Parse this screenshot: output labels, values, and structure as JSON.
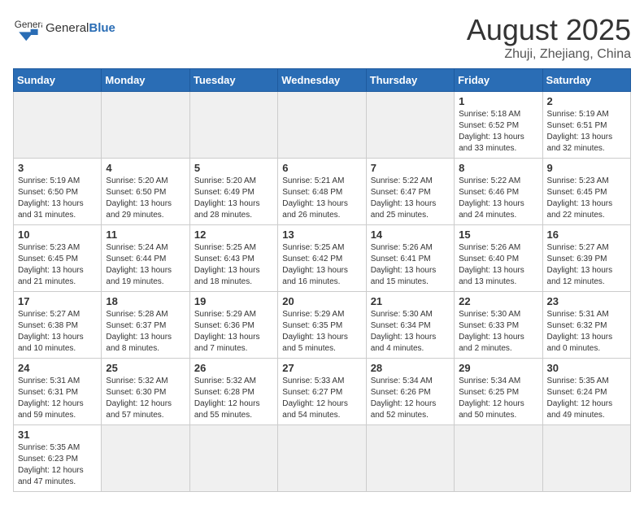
{
  "header": {
    "logo_general": "General",
    "logo_blue": "Blue",
    "title": "August 2025",
    "subtitle": "Zhuji, Zhejiang, China"
  },
  "weekdays": [
    "Sunday",
    "Monday",
    "Tuesday",
    "Wednesday",
    "Thursday",
    "Friday",
    "Saturday"
  ],
  "weeks": [
    [
      {
        "day": "",
        "info": ""
      },
      {
        "day": "",
        "info": ""
      },
      {
        "day": "",
        "info": ""
      },
      {
        "day": "",
        "info": ""
      },
      {
        "day": "",
        "info": ""
      },
      {
        "day": "1",
        "info": "Sunrise: 5:18 AM\nSunset: 6:52 PM\nDaylight: 13 hours\nand 33 minutes."
      },
      {
        "day": "2",
        "info": "Sunrise: 5:19 AM\nSunset: 6:51 PM\nDaylight: 13 hours\nand 32 minutes."
      }
    ],
    [
      {
        "day": "3",
        "info": "Sunrise: 5:19 AM\nSunset: 6:50 PM\nDaylight: 13 hours\nand 31 minutes."
      },
      {
        "day": "4",
        "info": "Sunrise: 5:20 AM\nSunset: 6:50 PM\nDaylight: 13 hours\nand 29 minutes."
      },
      {
        "day": "5",
        "info": "Sunrise: 5:20 AM\nSunset: 6:49 PM\nDaylight: 13 hours\nand 28 minutes."
      },
      {
        "day": "6",
        "info": "Sunrise: 5:21 AM\nSunset: 6:48 PM\nDaylight: 13 hours\nand 26 minutes."
      },
      {
        "day": "7",
        "info": "Sunrise: 5:22 AM\nSunset: 6:47 PM\nDaylight: 13 hours\nand 25 minutes."
      },
      {
        "day": "8",
        "info": "Sunrise: 5:22 AM\nSunset: 6:46 PM\nDaylight: 13 hours\nand 24 minutes."
      },
      {
        "day": "9",
        "info": "Sunrise: 5:23 AM\nSunset: 6:45 PM\nDaylight: 13 hours\nand 22 minutes."
      }
    ],
    [
      {
        "day": "10",
        "info": "Sunrise: 5:23 AM\nSunset: 6:45 PM\nDaylight: 13 hours\nand 21 minutes."
      },
      {
        "day": "11",
        "info": "Sunrise: 5:24 AM\nSunset: 6:44 PM\nDaylight: 13 hours\nand 19 minutes."
      },
      {
        "day": "12",
        "info": "Sunrise: 5:25 AM\nSunset: 6:43 PM\nDaylight: 13 hours\nand 18 minutes."
      },
      {
        "day": "13",
        "info": "Sunrise: 5:25 AM\nSunset: 6:42 PM\nDaylight: 13 hours\nand 16 minutes."
      },
      {
        "day": "14",
        "info": "Sunrise: 5:26 AM\nSunset: 6:41 PM\nDaylight: 13 hours\nand 15 minutes."
      },
      {
        "day": "15",
        "info": "Sunrise: 5:26 AM\nSunset: 6:40 PM\nDaylight: 13 hours\nand 13 minutes."
      },
      {
        "day": "16",
        "info": "Sunrise: 5:27 AM\nSunset: 6:39 PM\nDaylight: 13 hours\nand 12 minutes."
      }
    ],
    [
      {
        "day": "17",
        "info": "Sunrise: 5:27 AM\nSunset: 6:38 PM\nDaylight: 13 hours\nand 10 minutes."
      },
      {
        "day": "18",
        "info": "Sunrise: 5:28 AM\nSunset: 6:37 PM\nDaylight: 13 hours\nand 8 minutes."
      },
      {
        "day": "19",
        "info": "Sunrise: 5:29 AM\nSunset: 6:36 PM\nDaylight: 13 hours\nand 7 minutes."
      },
      {
        "day": "20",
        "info": "Sunrise: 5:29 AM\nSunset: 6:35 PM\nDaylight: 13 hours\nand 5 minutes."
      },
      {
        "day": "21",
        "info": "Sunrise: 5:30 AM\nSunset: 6:34 PM\nDaylight: 13 hours\nand 4 minutes."
      },
      {
        "day": "22",
        "info": "Sunrise: 5:30 AM\nSunset: 6:33 PM\nDaylight: 13 hours\nand 2 minutes."
      },
      {
        "day": "23",
        "info": "Sunrise: 5:31 AM\nSunset: 6:32 PM\nDaylight: 13 hours\nand 0 minutes."
      }
    ],
    [
      {
        "day": "24",
        "info": "Sunrise: 5:31 AM\nSunset: 6:31 PM\nDaylight: 12 hours\nand 59 minutes."
      },
      {
        "day": "25",
        "info": "Sunrise: 5:32 AM\nSunset: 6:30 PM\nDaylight: 12 hours\nand 57 minutes."
      },
      {
        "day": "26",
        "info": "Sunrise: 5:32 AM\nSunset: 6:28 PM\nDaylight: 12 hours\nand 55 minutes."
      },
      {
        "day": "27",
        "info": "Sunrise: 5:33 AM\nSunset: 6:27 PM\nDaylight: 12 hours\nand 54 minutes."
      },
      {
        "day": "28",
        "info": "Sunrise: 5:34 AM\nSunset: 6:26 PM\nDaylight: 12 hours\nand 52 minutes."
      },
      {
        "day": "29",
        "info": "Sunrise: 5:34 AM\nSunset: 6:25 PM\nDaylight: 12 hours\nand 50 minutes."
      },
      {
        "day": "30",
        "info": "Sunrise: 5:35 AM\nSunset: 6:24 PM\nDaylight: 12 hours\nand 49 minutes."
      }
    ],
    [
      {
        "day": "31",
        "info": "Sunrise: 5:35 AM\nSunset: 6:23 PM\nDaylight: 12 hours\nand 47 minutes."
      },
      {
        "day": "",
        "info": ""
      },
      {
        "day": "",
        "info": ""
      },
      {
        "day": "",
        "info": ""
      },
      {
        "day": "",
        "info": ""
      },
      {
        "day": "",
        "info": ""
      },
      {
        "day": "",
        "info": ""
      }
    ]
  ]
}
